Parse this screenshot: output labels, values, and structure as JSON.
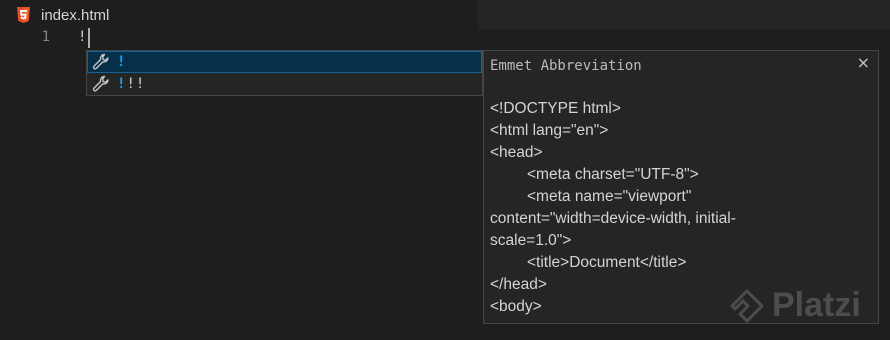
{
  "tab": {
    "filename": "index.html",
    "icon": "html5-icon"
  },
  "editor": {
    "line_number": "1",
    "line_text": "!"
  },
  "suggest": {
    "items": [
      {
        "label": "!",
        "icon": "wrench-icon",
        "selected": true
      },
      {
        "label_highlight": "!",
        "label_rest": "!!",
        "icon": "wrench-icon",
        "selected": false
      }
    ]
  },
  "details": {
    "title": "Emmet Abbreviation",
    "close": "×",
    "lines": [
      "<!DOCTYPE html>",
      "<html lang=\"en\">",
      "<head>",
      "<meta charset=\"UTF-8\">",
      "<meta name=\"viewport\"",
      "content=\"width=device-width, initial-",
      "scale=1.0\">",
      "<title>Document</title>",
      "</head>",
      "<body>"
    ]
  },
  "watermark": {
    "text": "Platzi"
  },
  "colors": {
    "background": "#1e1e1e",
    "tabbar": "#252526",
    "html5": "#e44d26",
    "selection": "#062f4a",
    "highlight": "#18a3ff"
  }
}
